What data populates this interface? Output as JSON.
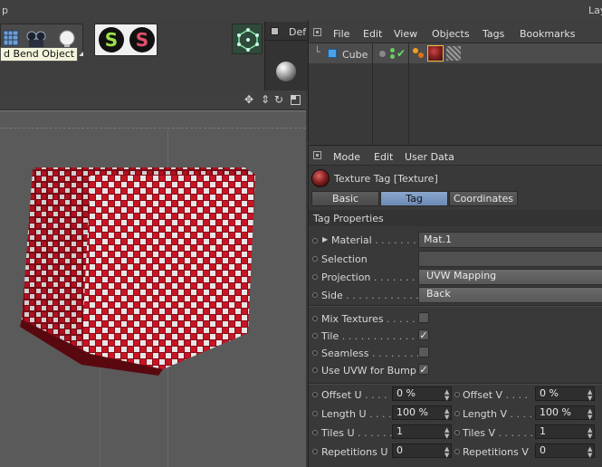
{
  "titlebar": {
    "left_label": "p",
    "right_label": "Lay"
  },
  "toolbar": {
    "tooltip": "d Bend Object",
    "buttons": [
      {
        "icon": "grid-icon"
      },
      {
        "icon": "camera-icon"
      },
      {
        "icon": "light-bulb-icon"
      },
      {
        "icon": "sculpt-s-green-icon",
        "glyph": "S"
      },
      {
        "icon": "sculpt-s-red-icon",
        "glyph": "S"
      },
      {
        "icon": "polygon-object-icon"
      }
    ]
  },
  "material_panel": {
    "label": "Def"
  },
  "object_manager": {
    "menu": [
      "File",
      "Edit",
      "View",
      "Objects",
      "Tags",
      "Bookmarks"
    ],
    "objects": [
      {
        "name": "Cube"
      }
    ]
  },
  "attribute_manager": {
    "menu": [
      "Mode",
      "Edit",
      "User Data"
    ],
    "header": "Texture Tag [Texture]",
    "tabs": [
      "Basic",
      "Tag",
      "Coordinates"
    ],
    "active_tab": "Tag",
    "section": "Tag Properties",
    "material": {
      "label": "Material",
      "dots": " . . . . . . .",
      "value": "Mat.1"
    },
    "selection": {
      "label": "Selection",
      "dots": "",
      "value": ""
    },
    "projection": {
      "label": "Projection",
      "dots": " . . . . . . .",
      "value": "UVW Mapping"
    },
    "side": {
      "label": "Side",
      "dots": " . . . . . . . . . . . .",
      "value": "Back"
    },
    "checks": [
      {
        "label": "Mix Textures",
        "dots": " . . . . .",
        "checked": false
      },
      {
        "label": "Tile",
        "dots": " . . . . . . . . . . . .",
        "checked": true
      },
      {
        "label": "Seamless",
        "dots": " . . . . . . . .",
        "checked": false
      },
      {
        "label": "Use UVW for Bump",
        "dots": "",
        "checked": true
      }
    ],
    "params_left": [
      {
        "label": "Offset U",
        "dots": " . . . .",
        "value": "0 %"
      },
      {
        "label": "Length U",
        "dots": " . . . .",
        "value": "100 %"
      },
      {
        "label": "Tiles U",
        "dots": " . . . . . .",
        "value": "1"
      },
      {
        "label": "Repetitions U",
        "dots": "",
        "value": "0"
      }
    ],
    "params_right": [
      {
        "label": "Offset V",
        "dots": " . . . .",
        "value": "0 %"
      },
      {
        "label": "Length V",
        "dots": " . . . .",
        "value": "100 %"
      },
      {
        "label": "Tiles V",
        "dots": " . . . . . .",
        "value": "1"
      },
      {
        "label": "Repetitions V",
        "dots": "",
        "value": "0"
      }
    ]
  },
  "colors": {
    "accent_tab": "#7a97c0",
    "checker_red": "#c01020",
    "checker_white": "#e8e8e8"
  }
}
